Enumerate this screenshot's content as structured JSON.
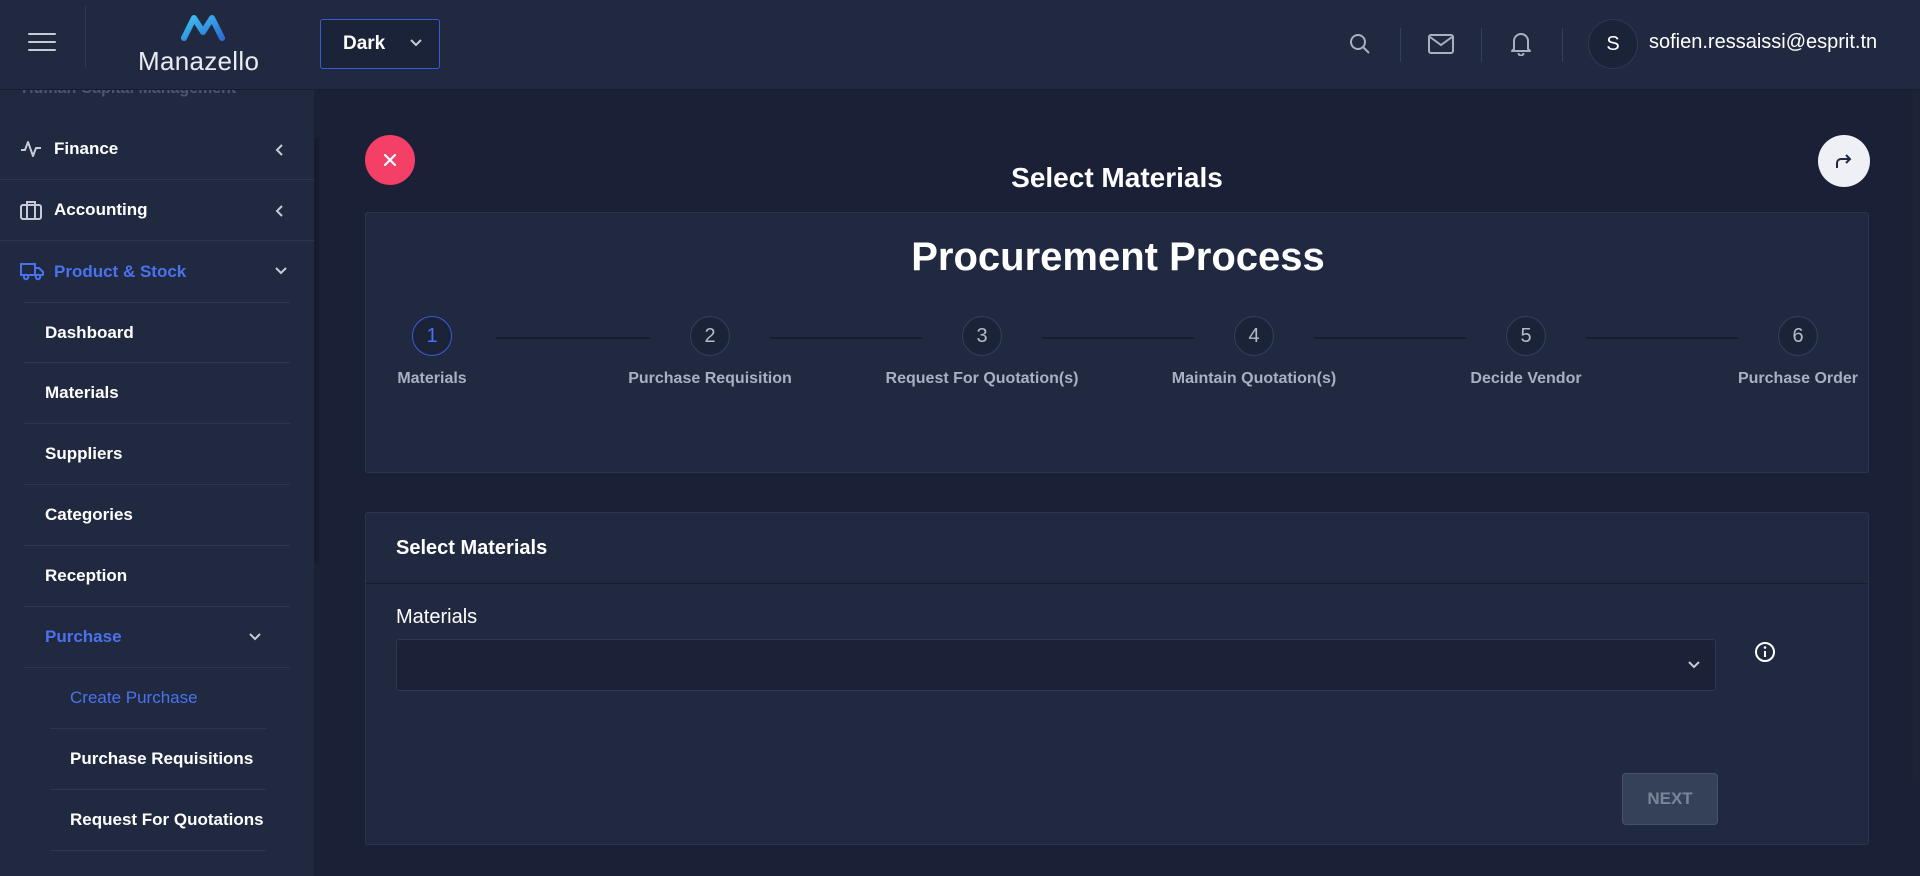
{
  "header": {
    "logo_text": "Manazello",
    "theme": "Dark",
    "avatar_initial": "S",
    "user_email": "sofien.ressaissi@esprit.tn"
  },
  "sidebar": {
    "cut_item": "Human Capital Management",
    "items": [
      {
        "label": "Finance",
        "icon": "activity-icon"
      },
      {
        "label": "Accounting",
        "icon": "briefcase-icon"
      },
      {
        "label": "Product & Stock",
        "icon": "truck-icon"
      }
    ],
    "sub_items": [
      "Dashboard",
      "Materials",
      "Suppliers",
      "Categories",
      "Reception",
      "Purchase"
    ],
    "purchase_items": [
      "Create Purchase",
      "Purchase Requisitions",
      "Request For Quotations"
    ]
  },
  "main": {
    "page_title": "Select Materials",
    "process_title": "Procurement Process",
    "steps": [
      {
        "num": "1",
        "label": "Materials"
      },
      {
        "num": "2",
        "label": "Purchase Requisition"
      },
      {
        "num": "3",
        "label": "Request For Quotation(s)"
      },
      {
        "num": "4",
        "label": "Maintain Quotation(s)"
      },
      {
        "num": "5",
        "label": "Decide Vendor"
      },
      {
        "num": "6",
        "label": "Purchase Order"
      }
    ],
    "card_title": "Select Materials",
    "materials_label": "Materials",
    "materials_value": "",
    "next_label": "NEXT"
  },
  "colors": {
    "accent": "#4a72ee",
    "close": "#f43f66",
    "surface": "#202940",
    "background": "#1a2035"
  }
}
